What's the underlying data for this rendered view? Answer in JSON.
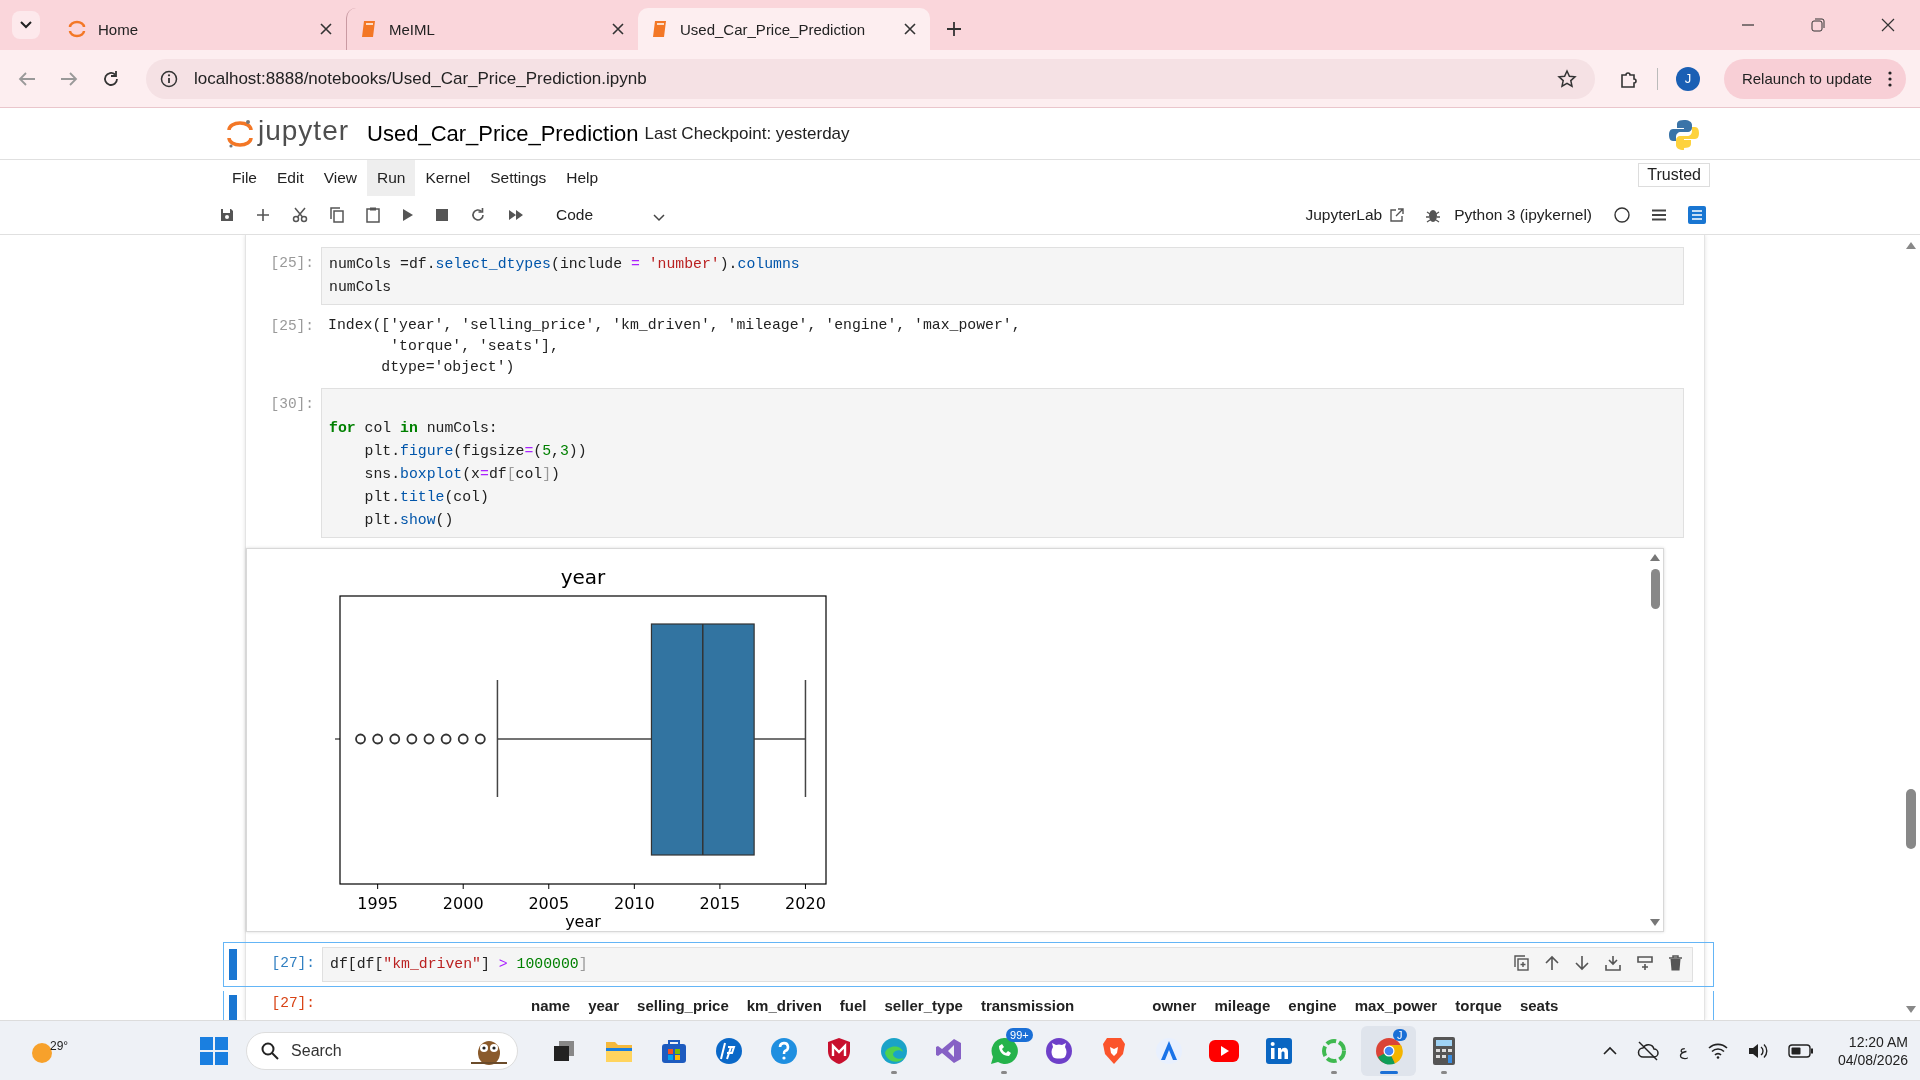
{
  "browser": {
    "tabs": [
      {
        "title": "Home",
        "kind": "jupyter",
        "selected": false
      },
      {
        "title": "MeIML",
        "kind": "notebook",
        "selected": false
      },
      {
        "title": "Used_Car_Price_Prediction",
        "kind": "notebook",
        "selected": true
      }
    ],
    "url": "localhost:8888/notebooks/Used_Car_Price_Prediction.ipynb",
    "profile": "J",
    "relaunch": "Relaunch to update"
  },
  "notebook": {
    "logo": "jupyter",
    "name": "Used_Car_Price_Prediction",
    "checkpoint": "Last Checkpoint: yesterday",
    "trusted": "Trusted"
  },
  "menu": [
    {
      "label": "File",
      "selected": false
    },
    {
      "label": "Edit",
      "selected": false
    },
    {
      "label": "View",
      "selected": false
    },
    {
      "label": "Run",
      "selected": true
    },
    {
      "label": "Kernel",
      "selected": false
    },
    {
      "label": "Settings",
      "selected": false
    },
    {
      "label": "Help",
      "selected": false
    }
  ],
  "toolbar": {
    "cell_type": "Code",
    "jupyterlab": "JupyterLab",
    "kernel": "Python 3 (ipykernel)"
  },
  "cells": [
    {
      "kind": "code",
      "prompt": "[25]:",
      "active": false,
      "lines": [
        {
          "kind": "code",
          "tokens": [
            {
              "t": "numCols =df.",
              "kind": "plain"
            },
            {
              "t": "select_dtypes",
              "kind": "func"
            },
            {
              "t": "(include ",
              "kind": "plain"
            },
            {
              "t": "=",
              "kind": "op"
            },
            {
              "t": " 'number'",
              "kind": "str"
            },
            {
              "t": ").",
              "kind": "plain"
            },
            {
              "t": "columns",
              "kind": "func"
            }
          ]
        },
        {
          "kind": "code",
          "tokens": [
            {
              "t": "numCols",
              "kind": "plain"
            }
          ]
        }
      ]
    },
    {
      "kind": "output",
      "prompt": "[25]:",
      "lines": [
        "Index(['year', 'selling_price', 'km_driven', 'mileage', 'engine', 'max_power',",
        "       'torque', 'seats'],",
        "      dtype='object')"
      ]
    },
    {
      "kind": "code",
      "prompt": "[30]:",
      "active": false,
      "lines": [
        {
          "kind": "blank"
        },
        {
          "kind": "code",
          "tokens": [
            {
              "t": "for",
              "kind": "kw"
            },
            {
              "t": " col ",
              "kind": "plain"
            },
            {
              "t": "in",
              "kind": "kw"
            },
            {
              "t": " numCols:",
              "kind": "plain"
            }
          ]
        },
        {
          "kind": "code",
          "tokens": [
            {
              "t": "    plt.",
              "kind": "plain"
            },
            {
              "t": "figure",
              "kind": "func"
            },
            {
              "t": "(figsize",
              "kind": "plain"
            },
            {
              "t": "=",
              "kind": "op"
            },
            {
              "t": "(",
              "kind": "plain"
            },
            {
              "t": "5",
              "kind": "num"
            },
            {
              "t": ",",
              "kind": "plain"
            },
            {
              "t": "3",
              "kind": "num"
            },
            {
              "t": "))",
              "kind": "plain"
            }
          ]
        },
        {
          "kind": "code",
          "tokens": [
            {
              "t": "    sns.",
              "kind": "plain"
            },
            {
              "t": "boxplot",
              "kind": "func"
            },
            {
              "t": "(x",
              "kind": "plain"
            },
            {
              "t": "=",
              "kind": "op"
            },
            {
              "t": "df",
              "kind": "plain"
            },
            {
              "t": "[",
              "kind": "bracket"
            },
            {
              "t": "col",
              "kind": "plain"
            },
            {
              "t": "]",
              "kind": "bracket"
            },
            {
              "t": ")",
              "kind": "plain"
            }
          ]
        },
        {
          "kind": "code",
          "tokens": [
            {
              "t": "    plt.",
              "kind": "plain"
            },
            {
              "t": "title",
              "kind": "func"
            },
            {
              "t": "(col)",
              "kind": "plain"
            }
          ]
        },
        {
          "kind": "code",
          "tokens": [
            {
              "t": "    plt.",
              "kind": "plain"
            },
            {
              "t": "show",
              "kind": "func"
            },
            {
              "t": "()",
              "kind": "plain"
            }
          ]
        }
      ]
    },
    {
      "kind": "plot",
      "title": "year",
      "xlabel": "year",
      "tick_labels": [
        "1995",
        "2000",
        "2005",
        "2010",
        "2015",
        "2020"
      ]
    },
    {
      "kind": "code",
      "prompt": "[27]:",
      "active": true,
      "lines": [
        {
          "kind": "code",
          "tokens": [
            {
              "t": "df[df[",
              "kind": "plain"
            },
            {
              "t": "\"km_driven\"",
              "kind": "str"
            },
            {
              "t": "] ",
              "kind": "plain"
            },
            {
              "t": ">",
              "kind": "op"
            },
            {
              "t": " 1000000",
              "kind": "num"
            },
            {
              "t": "]",
              "kind": "bracket"
            }
          ]
        }
      ]
    },
    {
      "kind": "table",
      "prompt": "[27]:",
      "columns": [
        "name",
        "year",
        "selling_price",
        "km_driven",
        "fuel",
        "seller_type",
        "transmission",
        "owner",
        "mileage",
        "engine",
        "max_power",
        "torque",
        "seats"
      ]
    }
  ],
  "taskbar": {
    "weather": "29°",
    "search": "Search",
    "apps": [
      {
        "kind": "taskview",
        "open": false,
        "selected": false
      },
      {
        "kind": "folder",
        "open": false,
        "selected": false
      },
      {
        "kind": "store",
        "open": false,
        "selected": false
      },
      {
        "kind": "hp",
        "open": false,
        "selected": false
      },
      {
        "kind": "help",
        "open": false,
        "selected": false
      },
      {
        "kind": "shield",
        "open": false,
        "selected": false
      },
      {
        "kind": "edge",
        "open": true,
        "selected": false
      },
      {
        "kind": "ribbon",
        "open": false,
        "selected": false
      },
      {
        "kind": "chat",
        "open": true,
        "selected": false,
        "badge": "99+"
      },
      {
        "kind": "cat",
        "open": false,
        "selected": false
      },
      {
        "kind": "lion",
        "open": false,
        "selected": false
      },
      {
        "kind": "compass",
        "open": false,
        "selected": false
      },
      {
        "kind": "play",
        "open": false,
        "selected": false
      },
      {
        "kind": "in",
        "open": false,
        "selected": false
      },
      {
        "kind": "ring",
        "open": true,
        "selected": false
      },
      {
        "kind": "chrome",
        "open": true,
        "selected": true,
        "badge": "J"
      },
      {
        "kind": "calc",
        "open": true,
        "selected": false
      }
    ],
    "language": "ع",
    "time": "12:20 AM",
    "date": "04/08/2026"
  }
}
